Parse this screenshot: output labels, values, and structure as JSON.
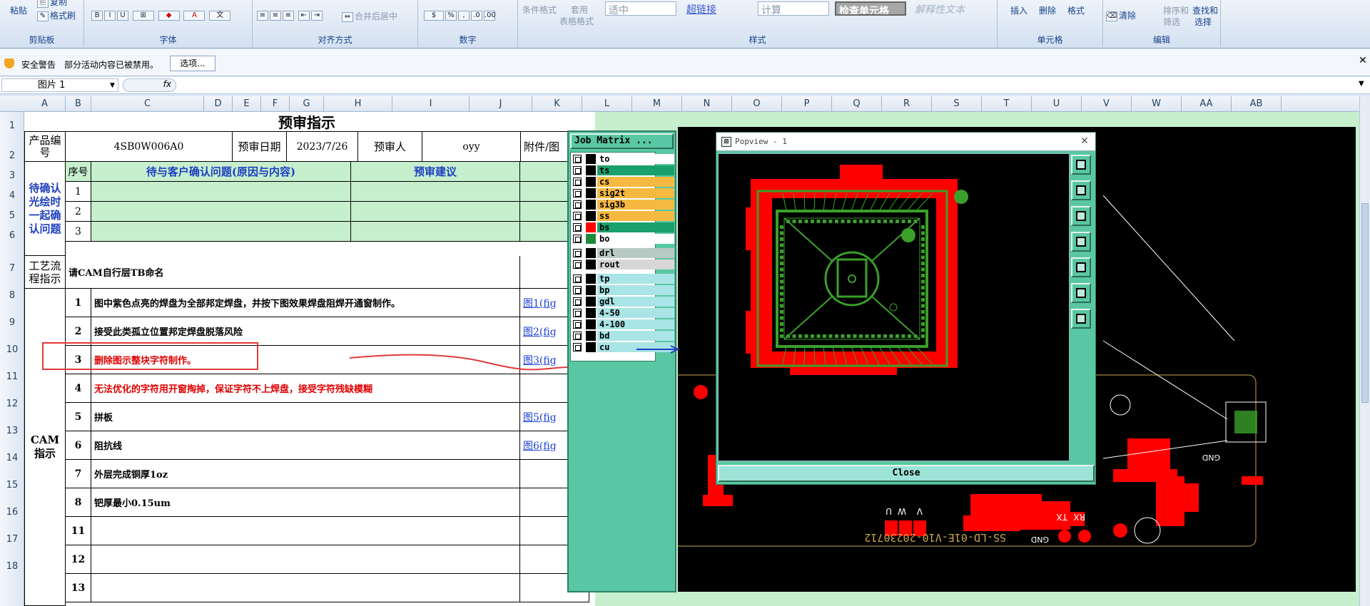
{
  "ribbon": {
    "paste": "粘贴",
    "copy": "复制",
    "format_painter": "格式刷",
    "groups": {
      "clipboard": "剪贴板",
      "font": "字体",
      "alignment": "对齐方式",
      "number": "数字",
      "styles": "样式",
      "cells": "单元格",
      "editing": "编辑"
    },
    "merge_center": "合并后居中",
    "conditional_format": "条件格式",
    "table_format_1": "套用",
    "table_format_2": "表格格式",
    "styles": [
      "适中",
      "超链接",
      "计算",
      "检查单元格",
      "解释性文本"
    ],
    "insert": "插入",
    "delete": "删除",
    "format": "格式",
    "clear": "清除",
    "sort_1": "排序和",
    "sort_2": "筛选",
    "find_1": "查找和",
    "find_2": "选择"
  },
  "security": {
    "title": "安全警告",
    "message": "部分活动内容已被禁用。",
    "options": "选项..."
  },
  "formula_bar": {
    "name_box": "图片 1",
    "fx": "fx"
  },
  "columns": [
    "A",
    "B",
    "C",
    "D",
    "E",
    "F",
    "G",
    "H",
    "I",
    "J",
    "K",
    "L",
    "M",
    "N",
    "O",
    "P",
    "Q",
    "R",
    "S",
    "T",
    "U",
    "V",
    "W",
    "AA",
    "AB"
  ],
  "rows": [
    "1",
    "2",
    "3",
    "4",
    "5",
    "6",
    "7",
    "8",
    "9",
    "10",
    "11",
    "12",
    "13",
    "14",
    "15",
    "16",
    "17",
    "18"
  ],
  "sheet": {
    "title": "预审指示",
    "product_label": "产品编号",
    "product_code": "4SB0W006A0",
    "date_label": "预审日期",
    "date": "2023/7/26",
    "reviewer_label": "预审人",
    "reviewer": "oyy",
    "attach_label": "附件/图",
    "seq_label": "序号",
    "issue_header": "待与客户确认问题(原因与内容)",
    "advice_header": "预审建议",
    "confirm_label": "待确认光绘时一起确认问题",
    "confirm_rows": [
      "1",
      "2",
      "3"
    ],
    "process_label": "工艺流程指示",
    "process_text": "请CAM自行层TB命名",
    "cam_label": "CAM指示",
    "cam_rows": [
      {
        "n": "1",
        "text": "图中紫色点亮的焊盘为全部邦定焊盘，并按下图效果焊盘阻焊开通窗制作。",
        "link": "图1(fig"
      },
      {
        "n": "2",
        "text": "接受此类孤立位置邦定焊盘脱落风险",
        "link": "图2(fig"
      },
      {
        "n": "3",
        "text": "删除图示整块字符制作。",
        "link": "图3(fig"
      },
      {
        "n": "4",
        "text": "无法优化的字符用开窗掏掉，保证字符不上焊盘，接受字符残缺模糊",
        "link": ""
      },
      {
        "n": "5",
        "text": "拼板",
        "link": "图5(fig"
      },
      {
        "n": "6",
        "text": "阻抗线",
        "link": "图6(fig"
      },
      {
        "n": "7",
        "text": "外层完成铜厚1oz",
        "link": ""
      },
      {
        "n": "8",
        "text": "钯厚最小0.15um",
        "link": ""
      },
      {
        "n": "11",
        "text": "",
        "link": ""
      },
      {
        "n": "12",
        "text": "",
        "link": ""
      },
      {
        "n": "13",
        "text": "",
        "link": ""
      }
    ]
  },
  "job_matrix": {
    "title": "Job Matrix ...",
    "layers": [
      {
        "name": "to",
        "color": "#ffffff",
        "swatch": "#000000"
      },
      {
        "name": "ts",
        "color": "#1aa06b",
        "swatch": "#000000"
      },
      {
        "name": "cs",
        "color": "#f5b942",
        "swatch": "#000000"
      },
      {
        "name": "sig2t",
        "color": "#f5b942",
        "swatch": "#000000"
      },
      {
        "name": "sig3b",
        "color": "#f5b942",
        "swatch": "#000000"
      },
      {
        "name": "ss",
        "color": "#f5b942",
        "swatch": "#000000"
      },
      {
        "name": "bs",
        "color": "#1aa06b",
        "swatch": "#ff0000"
      },
      {
        "name": "bo",
        "color": "#ffffff",
        "swatch": "#1f8a3a"
      },
      {
        "name": "drl",
        "color": "#b9c9c4",
        "swatch": "#000000"
      },
      {
        "name": "rout",
        "color": "#d7d7d7",
        "swatch": "#000000"
      },
      {
        "name": "tp",
        "color": "#a9e4e6",
        "swatch": "#000000"
      },
      {
        "name": "bp",
        "color": "#a9e4e6",
        "swatch": "#000000"
      },
      {
        "name": "gdl",
        "color": "#a9e4e6",
        "swatch": "#000000"
      },
      {
        "name": "4-50",
        "color": "#a9e4e6",
        "swatch": "#000000"
      },
      {
        "name": "4-100",
        "color": "#a9e4e6",
        "swatch": "#000000"
      },
      {
        "name": "bd",
        "color": "#a9e4e6",
        "swatch": "#000000"
      },
      {
        "name": "cu",
        "color": "#a9e4e6",
        "swatch": "#000000"
      }
    ]
  },
  "popview": {
    "title": "Popview - 1",
    "close": "Close",
    "close_x": "✕"
  },
  "pcb": {
    "board_text": "SS-LD-01E-V10-20230712",
    "labels": [
      "U",
      "W",
      "V",
      "RX",
      "TX",
      "GND",
      "GND"
    ]
  },
  "colors": {
    "green_fill": "#c6efce",
    "teal": "#59c7a3",
    "pad_red": "#ff0000",
    "trace_green": "#3aa02a"
  }
}
